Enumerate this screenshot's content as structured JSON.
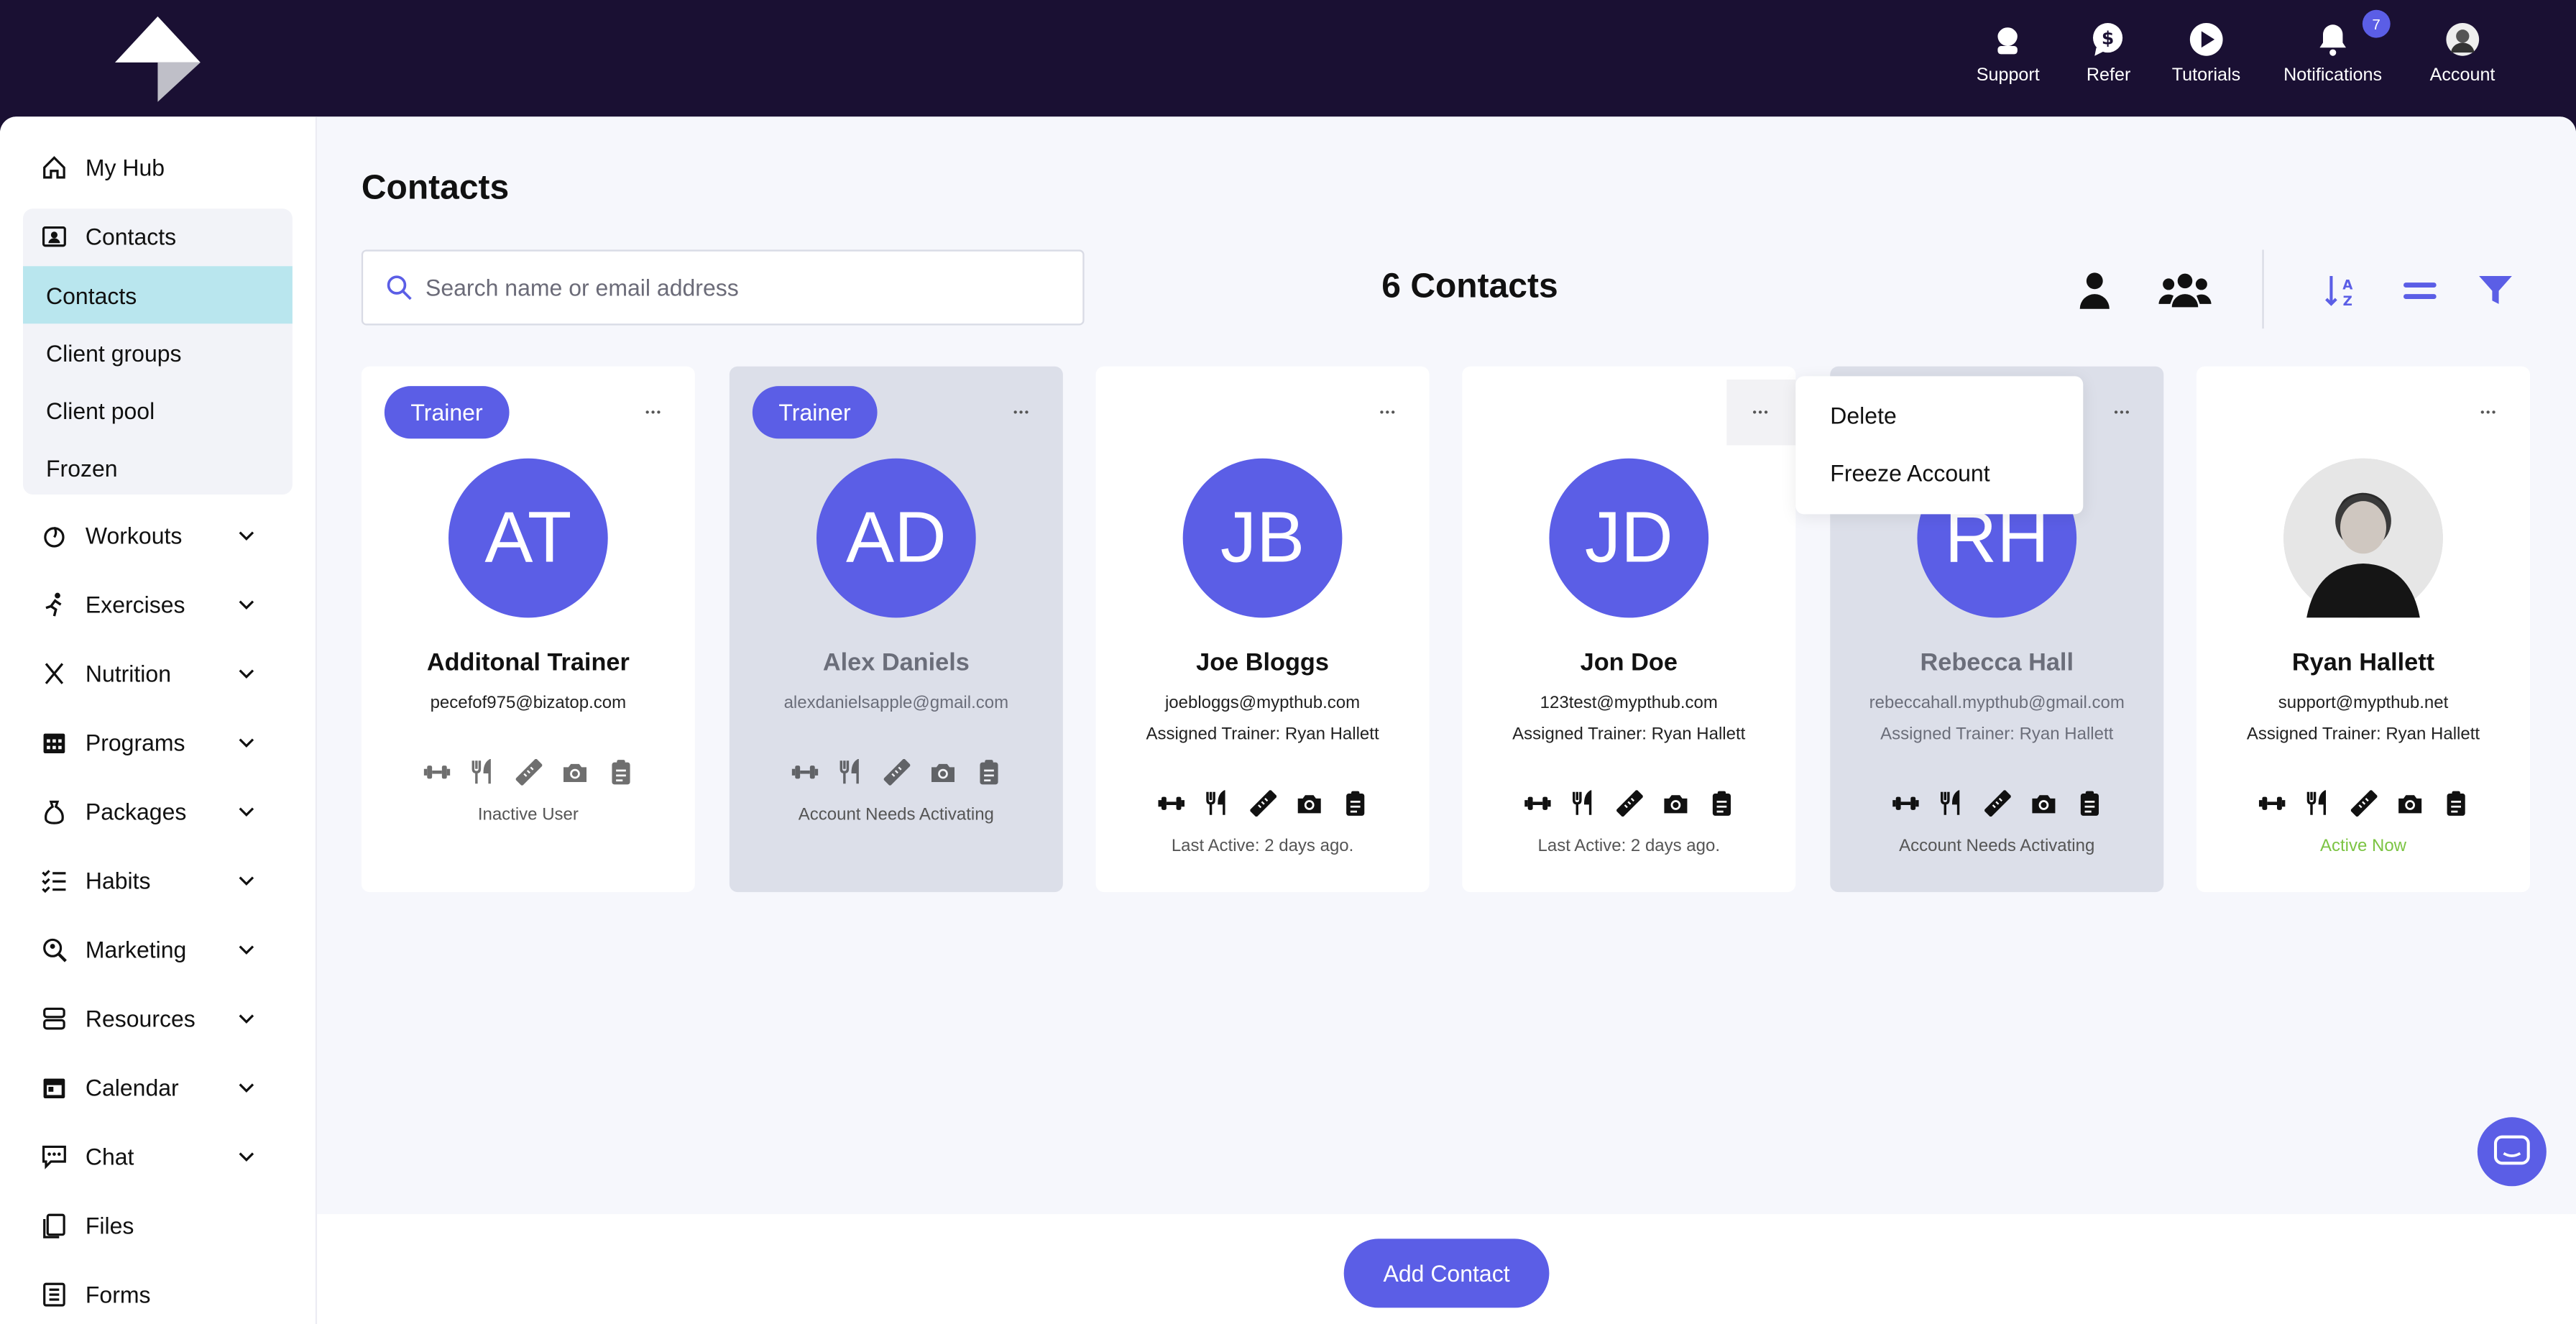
{
  "topnav": [
    {
      "label": "Support",
      "icon": "headset-icon"
    },
    {
      "label": "Refer",
      "icon": "dollar-chat-icon"
    },
    {
      "label": "Tutorials",
      "icon": "play-icon"
    },
    {
      "label": "Notifications",
      "icon": "bell-icon",
      "badge": "7"
    },
    {
      "label": "Account",
      "icon": "avatar-icon"
    }
  ],
  "sidebar": {
    "my_hub": "My Hub",
    "contacts": "Contacts",
    "sub": [
      "Contacts",
      "Client groups",
      "Client pool",
      "Frozen"
    ],
    "items": [
      "Workouts",
      "Exercises",
      "Nutrition",
      "Programs",
      "Packages",
      "Habits",
      "Marketing",
      "Resources",
      "Calendar",
      "Chat",
      "Files",
      "Forms"
    ]
  },
  "main": {
    "title": "Contacts",
    "search_placeholder": "Search name or email address",
    "count": "6 Contacts",
    "add_button": "Add Contact"
  },
  "menu": {
    "delete": "Delete",
    "freeze": "Freeze Account"
  },
  "cards": [
    {
      "tag": "Trainer",
      "initials": "AT",
      "name": "Additonal Trainer",
      "email": "pecefof975@bizatop.com",
      "trainer": "",
      "status": "Inactive User"
    },
    {
      "tag": "Trainer",
      "initials": "AD",
      "name": "Alex Daniels",
      "email": "alexdanielsapple@gmail.com",
      "trainer": "",
      "status": "Account Needs Activating"
    },
    {
      "tag": "",
      "initials": "JB",
      "name": "Joe Bloggs",
      "email": "joebloggs@mypthub.com",
      "trainer": "Assigned Trainer: Ryan Hallett",
      "status": "Last Active: 2 days ago."
    },
    {
      "tag": "",
      "initials": "JD",
      "name": "Jon Doe",
      "email": "123test@mypthub.com",
      "trainer": "Assigned Trainer: Ryan Hallett",
      "status": "Last Active: 2 days ago."
    },
    {
      "tag": "",
      "initials": "RH",
      "name": "Rebecca Hall",
      "email": "rebeccahall.mypthub@gmail.com",
      "trainer": "Assigned Trainer: Ryan Hallett",
      "status": "Account Needs Activating"
    },
    {
      "tag": "",
      "initials": "",
      "name": "Ryan Hallett",
      "email": "support@mypthub.net",
      "trainer": "Assigned Trainer: Ryan Hallett",
      "status": "Active Now"
    }
  ],
  "colors": {
    "accent": "#5b5ee6",
    "topbar": "#1a1033",
    "active_sub": "#b9e6ee",
    "active_green": "#7cc443"
  }
}
